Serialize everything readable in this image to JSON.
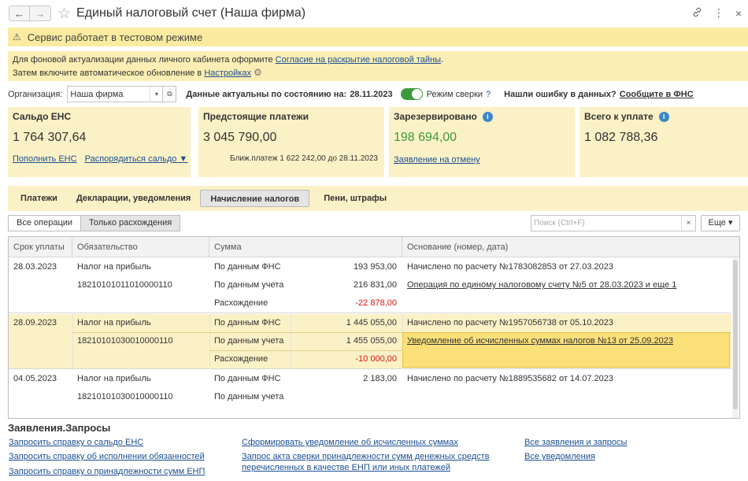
{
  "window": {
    "title": "Единый налоговый счет (Наша фирма)",
    "back_icon": "←",
    "forward_icon": "→",
    "star_icon": "☆",
    "link_icon": "🔗",
    "menu_icon": "⋮",
    "close_icon": "×"
  },
  "test_banner": {
    "icon": "⚠",
    "text": "Сервис работает в тестовом режиме"
  },
  "info": {
    "line1_prefix": "Для фоновой актуализации данных личного кабинета оформите ",
    "line1_link": "Согласие на раскрытие налоговой тайны",
    "line1_suffix": ".",
    "line2_prefix": "Затем включите автоматическое обновление в ",
    "line2_link": "Настройках",
    "gear_icon": "⚙"
  },
  "org": {
    "label": "Организация:",
    "value": "Наша фирма",
    "dropdown_icon": "▾",
    "open_icon": "⧉",
    "data_date_label": "Данные актуальны по состоянию на:",
    "data_date": "28.11.2023",
    "reconcile_label": "Режим сверки",
    "help_icon": "?",
    "error_question": "Нашли ошибку в данных?",
    "report_link": "Сообщите в ФНС"
  },
  "cards": {
    "saldo": {
      "title": "Сальдо ЕНС",
      "value": "1 764 307,64",
      "link1": "Пополнить ЕНС",
      "link2": "Распорядиться сальдо ▼"
    },
    "upcoming": {
      "title": "Предстоящие платежи",
      "value": "3 045 790,00",
      "note": "Ближ.платеж 1 622 242,00 до 28.11.2023"
    },
    "reserved": {
      "title": "Зарезервировано",
      "info_icon": "i",
      "value": "198 694,00",
      "link": "Заявление на отмену",
      "color": "#3a9a3a"
    },
    "total": {
      "title": "Всего к уплате",
      "info_icon": "i",
      "value": "1 082 788,36"
    }
  },
  "tabs": [
    "Платежи",
    "Декларации, уведомления",
    "Начисление налогов",
    "Пени, штрафы"
  ],
  "active_tab": "Начисление налогов",
  "filter": {
    "all_ops": "Все операции",
    "only_diff": "Только расхождения",
    "search_placeholder": "Поиск (Ctrl+F)",
    "clear_icon": "×",
    "more": "Еще ▾"
  },
  "table": {
    "headers": [
      "Срок уплаты",
      "Обязательство",
      "Сумма",
      "Основание (номер, дата)"
    ],
    "groups": [
      {
        "date": "28.03.2023",
        "tax": "Налог на прибыль",
        "kbk": "18210101011010000110",
        "rows": [
          {
            "label": "По данным ФНС",
            "amount": "193 953,00",
            "basis": "Начислено по расчету №1783082853 от 27.03.2023",
            "basis_link": false
          },
          {
            "label": "По данным учета",
            "amount": "216 831,00",
            "basis": "Операция по единому налоговому счету №5 от 28.03.2023 и еще 1",
            "basis_link": true
          },
          {
            "label": "Расхождение",
            "amount": "-22 878,00",
            "basis": "",
            "basis_link": false
          }
        ]
      },
      {
        "date": "28.09.2023",
        "tax": "Налог на прибыль",
        "kbk": "18210101030010000110",
        "rows": [
          {
            "label": "По данным ФНС",
            "amount": "1 445 055,00",
            "basis": "Начислено по расчету №1957056738 от 05.10.2023",
            "basis_link": false
          },
          {
            "label": "По данным учета",
            "amount": "1 455 055,00",
            "basis": "Уведомление об исчисленных суммах налогов №13 от 25.09.2023",
            "basis_link": true
          },
          {
            "label": "Расхождение",
            "amount": "-10 000,00",
            "basis": "",
            "basis_link": false
          }
        ]
      },
      {
        "date": "04.05.2023",
        "tax": "Налог на прибыль",
        "kbk": "18210101030010000110",
        "rows": [
          {
            "label": "По данным ФНС",
            "amount": "2 183,00",
            "basis": "Начислено по расчету №1889535682 от 14.07.2023",
            "basis_link": false
          },
          {
            "label": "По данным учета",
            "amount": "",
            "basis": "",
            "basis_link": false
          }
        ]
      }
    ]
  },
  "requests": {
    "title": "Заявления.Запросы",
    "col1": [
      "Запросить справку о сальдо ЕНС",
      "Запросить справку об исполнении обязанностей",
      "Запросить справку о принадлежности сумм ЕНП"
    ],
    "col2": [
      "Сформировать уведомление об исчисленных суммах",
      "Запрос акта сверки принадлежности сумм денежных средств",
      "перечисленных в качестве ЕНП или иных платежей"
    ],
    "col3": [
      "Все заявления и запросы",
      "Все уведомления"
    ]
  }
}
